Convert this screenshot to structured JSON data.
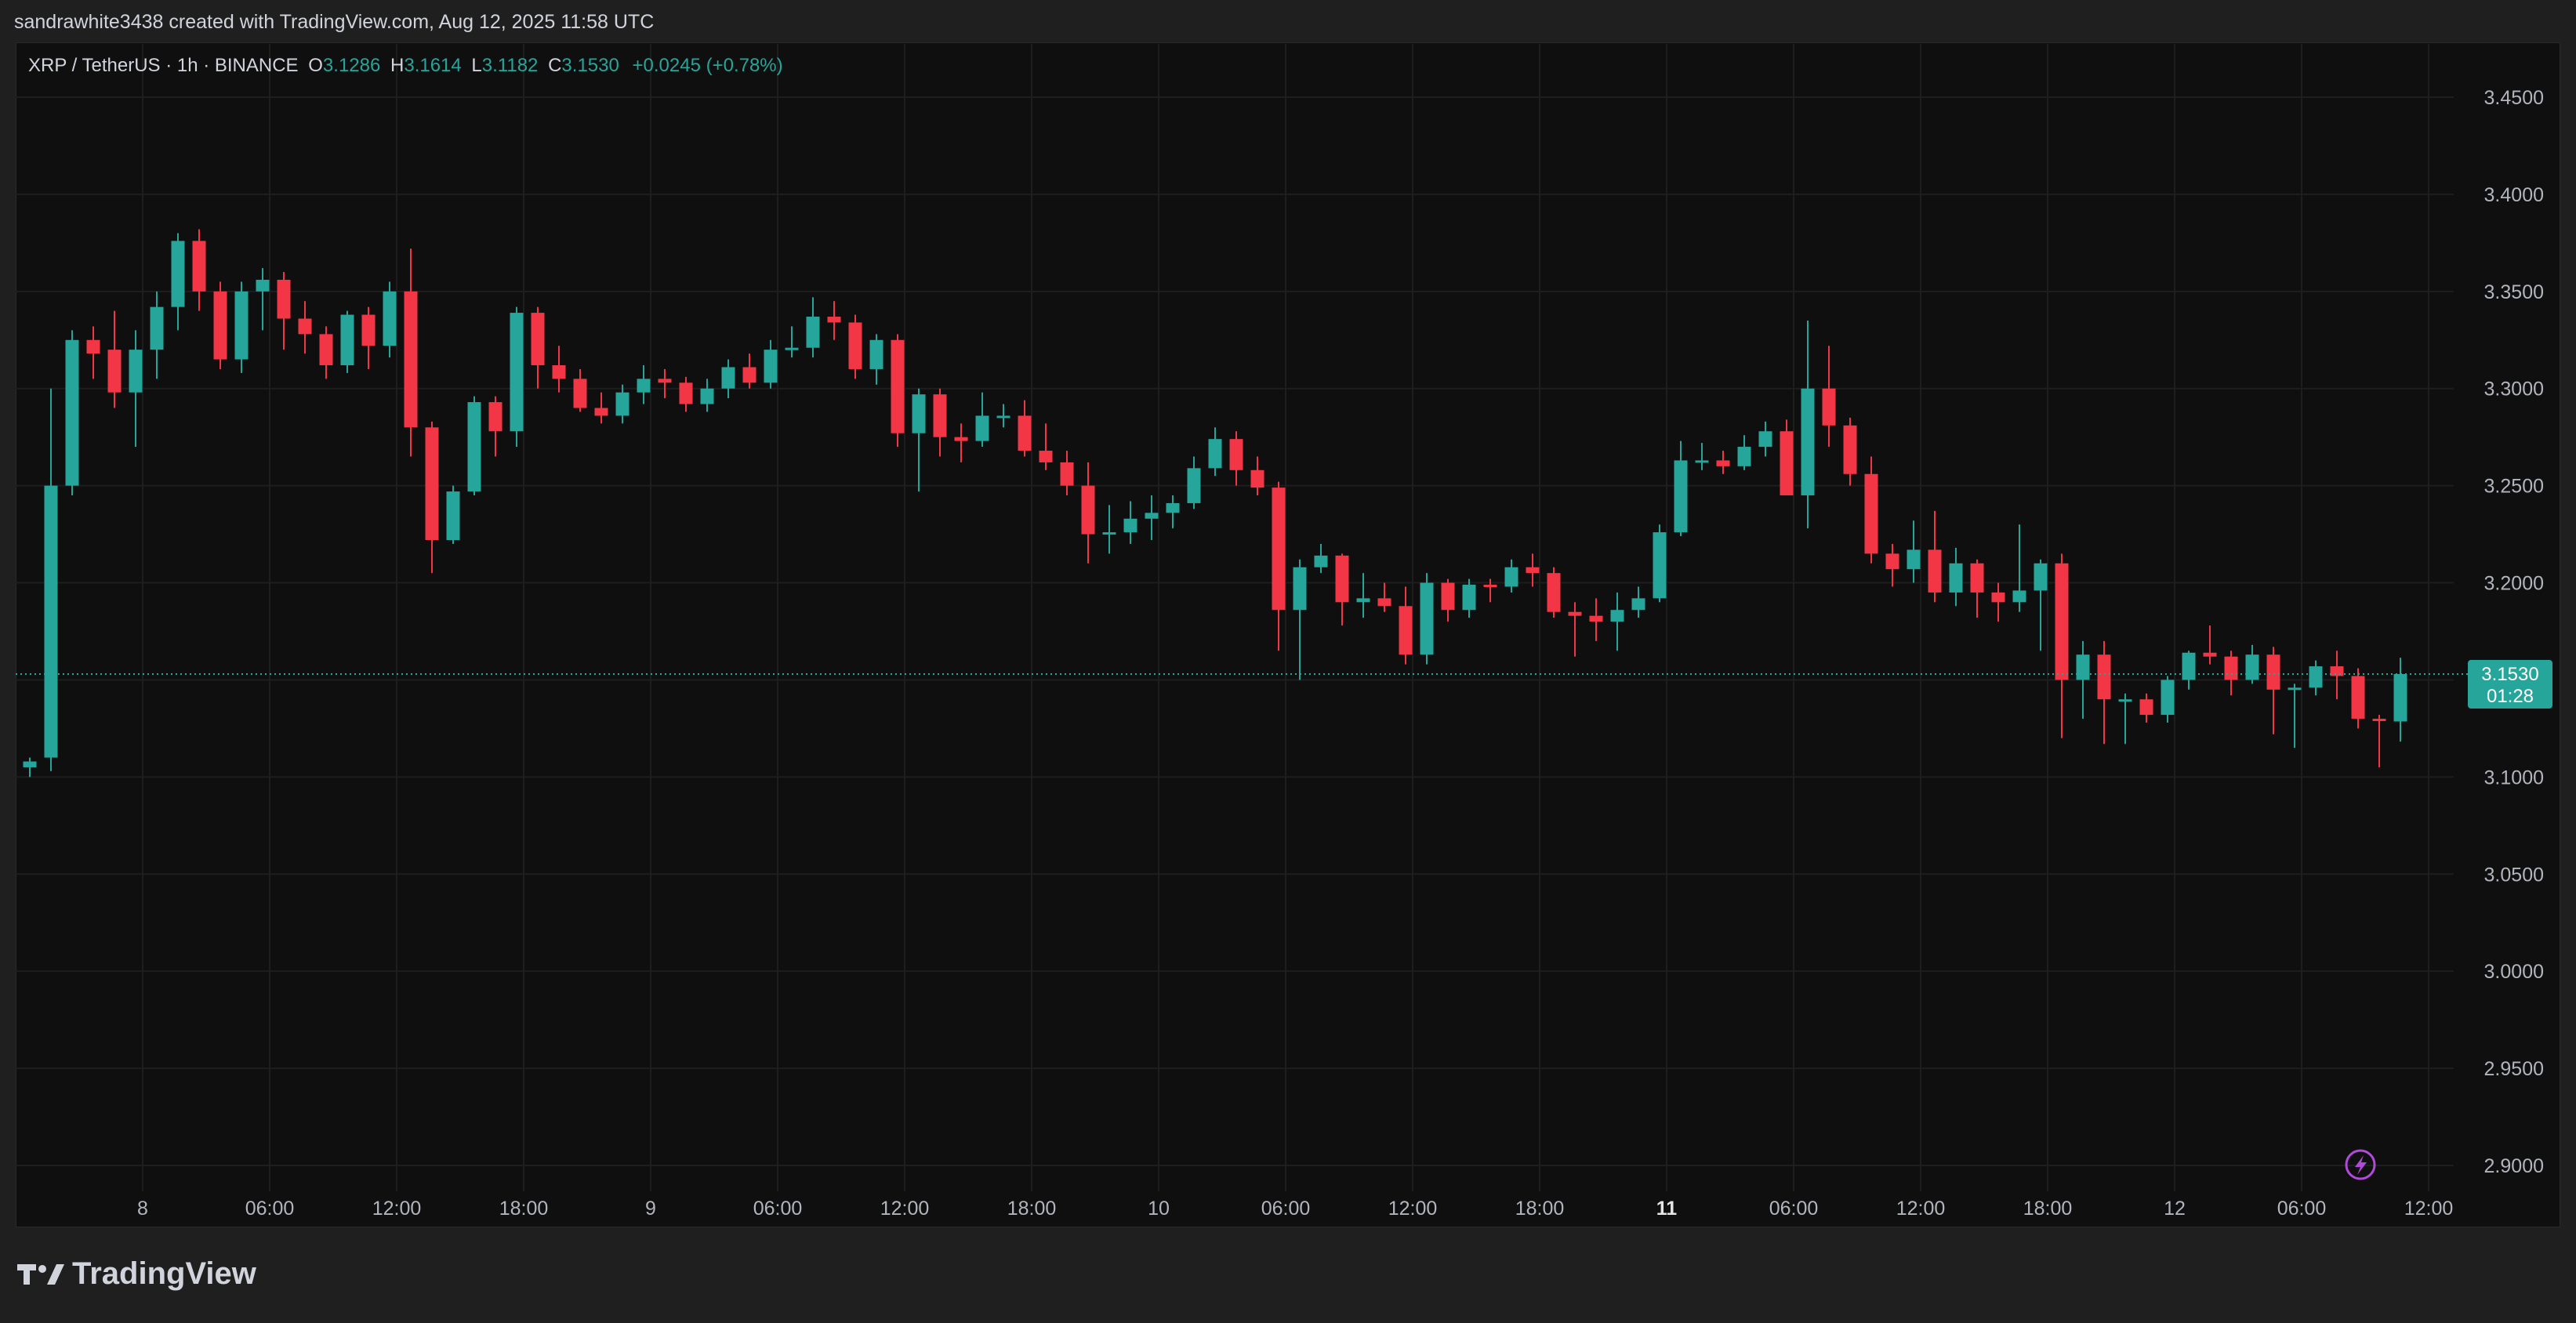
{
  "header": {
    "credit": "sandrawhite3438 created with TradingView.com, Aug 12, 2025 11:58 UTC"
  },
  "legend": {
    "symbol": "XRP / TetherUS · 1h · BINANCE",
    "open_label": "O",
    "open": "3.1286",
    "high_label": "H",
    "high": "3.1614",
    "low_label": "L",
    "low": "3.1182",
    "close_label": "C",
    "close": "3.1530",
    "change": "+0.0245 (+0.78%)"
  },
  "brand": {
    "name": "TradingView"
  },
  "colors": {
    "up": "#26a69a",
    "down": "#f23645",
    "grid": "#1e1e1e",
    "text": "#b2b5be",
    "background": "#0f0f0f"
  },
  "icons": [
    "tradingview-logo-icon",
    "lightning-icon"
  ],
  "chart_data": {
    "type": "candlestick",
    "interval": "1h",
    "ylim": [
      2.885,
      3.465
    ],
    "y_ticks": [
      "3.4500",
      "3.4000",
      "3.3500",
      "3.3000",
      "3.2500",
      "3.2000",
      "3.1500",
      "3.1000",
      "3.0500",
      "3.0000",
      "2.9500",
      "2.9000"
    ],
    "x_ticks": [
      {
        "label": "8",
        "index": 4,
        "bold": false
      },
      {
        "label": "06:00",
        "index": 10,
        "bold": false
      },
      {
        "label": "12:00",
        "index": 16,
        "bold": false
      },
      {
        "label": "18:00",
        "index": 22,
        "bold": false
      },
      {
        "label": "9",
        "index": 28,
        "bold": false
      },
      {
        "label": "06:00",
        "index": 34,
        "bold": false
      },
      {
        "label": "12:00",
        "index": 40,
        "bold": false
      },
      {
        "label": "18:00",
        "index": 46,
        "bold": false
      },
      {
        "label": "10",
        "index": 52,
        "bold": false
      },
      {
        "label": "06:00",
        "index": 58,
        "bold": false
      },
      {
        "label": "12:00",
        "index": 64,
        "bold": false
      },
      {
        "label": "18:00",
        "index": 70,
        "bold": false
      },
      {
        "label": "11",
        "index": 76,
        "bold": true
      },
      {
        "label": "06:00",
        "index": 82,
        "bold": false
      },
      {
        "label": "12:00",
        "index": 88,
        "bold": false
      },
      {
        "label": "18:00",
        "index": 94,
        "bold": false
      },
      {
        "label": "12",
        "index": 100,
        "bold": false
      },
      {
        "label": "06:00",
        "index": 106,
        "bold": false
      },
      {
        "label": "12:00",
        "index": 112,
        "bold": false
      }
    ],
    "last_price": "3.1530",
    "countdown": "01:28",
    "ohlc": [
      [
        3.105,
        3.11,
        3.1,
        3.108
      ],
      [
        3.11,
        3.3,
        3.103,
        3.25
      ],
      [
        3.25,
        3.33,
        3.245,
        3.325
      ],
      [
        3.325,
        3.332,
        3.305,
        3.318
      ],
      [
        3.32,
        3.34,
        3.29,
        3.298
      ],
      [
        3.298,
        3.33,
        3.27,
        3.32
      ],
      [
        3.32,
        3.35,
        3.305,
        3.342
      ],
      [
        3.342,
        3.38,
        3.33,
        3.376
      ],
      [
        3.376,
        3.382,
        3.34,
        3.35
      ],
      [
        3.35,
        3.355,
        3.31,
        3.315
      ],
      [
        3.315,
        3.355,
        3.308,
        3.35
      ],
      [
        3.35,
        3.362,
        3.33,
        3.356
      ],
      [
        3.356,
        3.36,
        3.32,
        3.336
      ],
      [
        3.336,
        3.345,
        3.318,
        3.328
      ],
      [
        3.328,
        3.332,
        3.305,
        3.312
      ],
      [
        3.312,
        3.34,
        3.308,
        3.338
      ],
      [
        3.338,
        3.342,
        3.31,
        3.322
      ],
      [
        3.322,
        3.355,
        3.316,
        3.35
      ],
      [
        3.35,
        3.372,
        3.265,
        3.28
      ],
      [
        3.28,
        3.283,
        3.205,
        3.222
      ],
      [
        3.222,
        3.25,
        3.22,
        3.247
      ],
      [
        3.247,
        3.296,
        3.245,
        3.293
      ],
      [
        3.293,
        3.296,
        3.265,
        3.278
      ],
      [
        3.278,
        3.342,
        3.27,
        3.339
      ],
      [
        3.339,
        3.342,
        3.3,
        3.312
      ],
      [
        3.312,
        3.322,
        3.298,
        3.305
      ],
      [
        3.305,
        3.31,
        3.288,
        3.29
      ],
      [
        3.29,
        3.298,
        3.282,
        3.286
      ],
      [
        3.286,
        3.302,
        3.282,
        3.298
      ],
      [
        3.298,
        3.312,
        3.292,
        3.305
      ],
      [
        3.305,
        3.31,
        3.295,
        3.303
      ],
      [
        3.303,
        3.306,
        3.288,
        3.292
      ],
      [
        3.292,
        3.305,
        3.288,
        3.3
      ],
      [
        3.3,
        3.315,
        3.295,
        3.311
      ],
      [
        3.311,
        3.318,
        3.3,
        3.303
      ],
      [
        3.303,
        3.325,
        3.3,
        3.32
      ],
      [
        3.32,
        3.332,
        3.316,
        3.321
      ],
      [
        3.321,
        3.347,
        3.316,
        3.337
      ],
      [
        3.337,
        3.345,
        3.325,
        3.334
      ],
      [
        3.334,
        3.338,
        3.305,
        3.31
      ],
      [
        3.31,
        3.328,
        3.302,
        3.325
      ],
      [
        3.325,
        3.328,
        3.27,
        3.277
      ],
      [
        3.277,
        3.3,
        3.247,
        3.297
      ],
      [
        3.297,
        3.3,
        3.265,
        3.275
      ],
      [
        3.275,
        3.282,
        3.262,
        3.273
      ],
      [
        3.273,
        3.298,
        3.27,
        3.286
      ],
      [
        3.286,
        3.292,
        3.28,
        3.286
      ],
      [
        3.286,
        3.294,
        3.265,
        3.268
      ],
      [
        3.268,
        3.282,
        3.258,
        3.262
      ],
      [
        3.262,
        3.268,
        3.245,
        3.25
      ],
      [
        3.25,
        3.262,
        3.21,
        3.225
      ],
      [
        3.225,
        3.24,
        3.215,
        3.226
      ],
      [
        3.226,
        3.242,
        3.22,
        3.233
      ],
      [
        3.233,
        3.245,
        3.222,
        3.236
      ],
      [
        3.236,
        3.245,
        3.228,
        3.241
      ],
      [
        3.241,
        3.265,
        3.238,
        3.259
      ],
      [
        3.259,
        3.28,
        3.255,
        3.274
      ],
      [
        3.274,
        3.278,
        3.25,
        3.258
      ],
      [
        3.258,
        3.265,
        3.245,
        3.249
      ],
      [
        3.249,
        3.252,
        3.165,
        3.186
      ],
      [
        3.186,
        3.212,
        3.15,
        3.208
      ],
      [
        3.208,
        3.22,
        3.205,
        3.214
      ],
      [
        3.214,
        3.215,
        3.178,
        3.19
      ],
      [
        3.19,
        3.205,
        3.182,
        3.192
      ],
      [
        3.192,
        3.2,
        3.185,
        3.188
      ],
      [
        3.188,
        3.198,
        3.158,
        3.163
      ],
      [
        3.163,
        3.205,
        3.158,
        3.2
      ],
      [
        3.2,
        3.202,
        3.18,
        3.186
      ],
      [
        3.186,
        3.202,
        3.182,
        3.199
      ],
      [
        3.199,
        3.202,
        3.19,
        3.198
      ],
      [
        3.198,
        3.212,
        3.195,
        3.208
      ],
      [
        3.208,
        3.215,
        3.198,
        3.205
      ],
      [
        3.205,
        3.208,
        3.182,
        3.185
      ],
      [
        3.185,
        3.19,
        3.162,
        3.183
      ],
      [
        3.183,
        3.192,
        3.17,
        3.18
      ],
      [
        3.18,
        3.195,
        3.165,
        3.186
      ],
      [
        3.186,
        3.198,
        3.182,
        3.192
      ],
      [
        3.192,
        3.23,
        3.19,
        3.226
      ],
      [
        3.226,
        3.273,
        3.224,
        3.263
      ],
      [
        3.263,
        3.272,
        3.258,
        3.263
      ],
      [
        3.263,
        3.268,
        3.256,
        3.26
      ],
      [
        3.26,
        3.276,
        3.258,
        3.27
      ],
      [
        3.27,
        3.283,
        3.265,
        3.278
      ],
      [
        3.278,
        3.284,
        3.25,
        3.245
      ],
      [
        3.245,
        3.335,
        3.228,
        3.3
      ],
      [
        3.3,
        3.322,
        3.27,
        3.281
      ],
      [
        3.281,
        3.285,
        3.25,
        3.256
      ],
      [
        3.256,
        3.265,
        3.21,
        3.215
      ],
      [
        3.215,
        3.22,
        3.198,
        3.207
      ],
      [
        3.207,
        3.232,
        3.2,
        3.217
      ],
      [
        3.217,
        3.237,
        3.19,
        3.195
      ],
      [
        3.195,
        3.218,
        3.188,
        3.21
      ],
      [
        3.21,
        3.212,
        3.182,
        3.195
      ],
      [
        3.195,
        3.2,
        3.18,
        3.19
      ],
      [
        3.19,
        3.23,
        3.185,
        3.196
      ],
      [
        3.196,
        3.212,
        3.165,
        3.21
      ],
      [
        3.21,
        3.215,
        3.12,
        3.15
      ],
      [
        3.15,
        3.17,
        3.13,
        3.163
      ],
      [
        3.163,
        3.17,
        3.117,
        3.14
      ],
      [
        3.14,
        3.143,
        3.117,
        3.14
      ],
      [
        3.14,
        3.143,
        3.128,
        3.132
      ],
      [
        3.132,
        3.152,
        3.128,
        3.15
      ],
      [
        3.15,
        3.165,
        3.145,
        3.164
      ],
      [
        3.164,
        3.178,
        3.158,
        3.162
      ],
      [
        3.162,
        3.165,
        3.142,
        3.15
      ],
      [
        3.15,
        3.168,
        3.148,
        3.163
      ],
      [
        3.163,
        3.167,
        3.122,
        3.145
      ],
      [
        3.145,
        3.148,
        3.115,
        3.146
      ],
      [
        3.146,
        3.16,
        3.142,
        3.157
      ],
      [
        3.157,
        3.165,
        3.14,
        3.152
      ],
      [
        3.152,
        3.156,
        3.125,
        3.13
      ],
      [
        3.13,
        3.132,
        3.105,
        3.129
      ],
      [
        3.1286,
        3.1614,
        3.1182,
        3.153
      ]
    ]
  }
}
